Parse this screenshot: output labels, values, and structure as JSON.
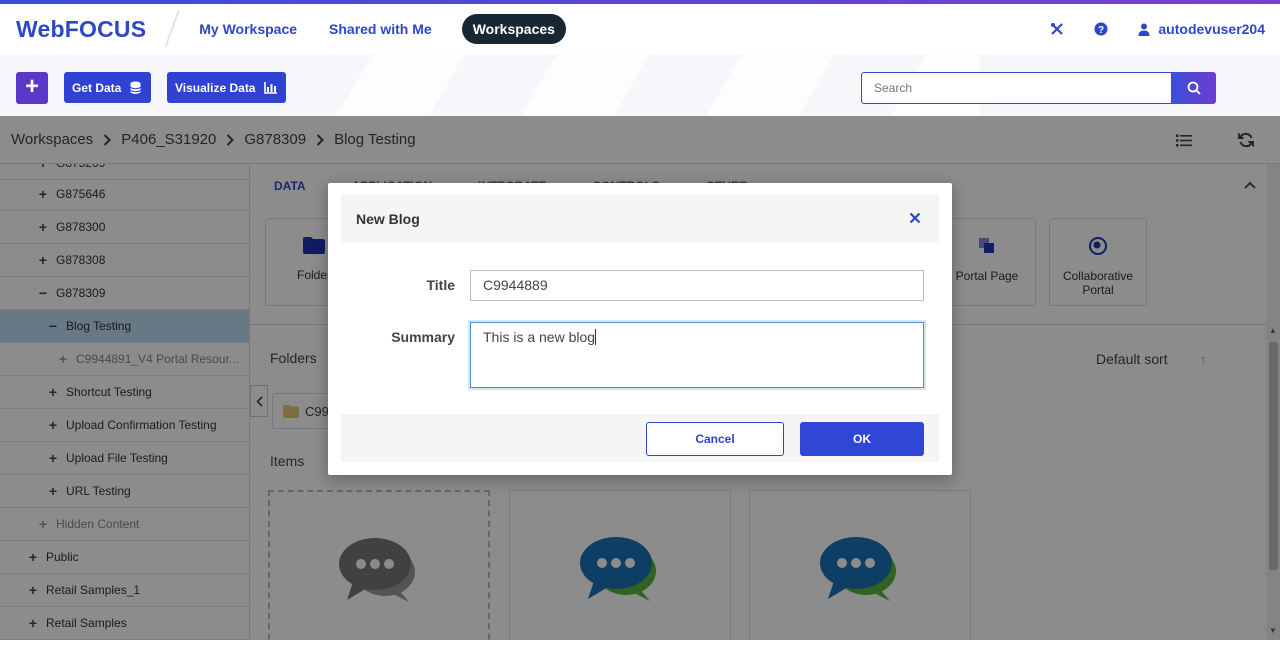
{
  "app": {
    "logo": "WebFOCUS"
  },
  "nav": {
    "my_workspace": "My Workspace",
    "shared": "Shared with Me",
    "workspaces": "Workspaces"
  },
  "user": {
    "name": "autodevuser204"
  },
  "toolbar": {
    "get_data": "Get Data",
    "visualize_data": "Visualize Data",
    "search_placeholder": "Search"
  },
  "breadcrumb": [
    "Workspaces",
    "P406_S31920",
    "G878309",
    "Blog Testing"
  ],
  "sidebar": {
    "items": [
      {
        "label": "G875646",
        "toggle": "+"
      },
      {
        "label": "G878300",
        "toggle": "+"
      },
      {
        "label": "G878308",
        "toggle": "+"
      },
      {
        "label": "G878309",
        "toggle": "−"
      },
      {
        "label": "Blog Testing",
        "toggle": "−"
      },
      {
        "label": "C9944891_V4 Portal Resour...",
        "toggle": "+"
      },
      {
        "label": "Shortcut Testing",
        "toggle": "+"
      },
      {
        "label": "Upload Confirmation Testing",
        "toggle": "+"
      },
      {
        "label": "Upload File Testing",
        "toggle": "+"
      },
      {
        "label": "URL Testing",
        "toggle": "+"
      },
      {
        "label": "Hidden Content",
        "toggle": "+"
      },
      {
        "label": "Public",
        "toggle": "+"
      },
      {
        "label": "Retail Samples_1",
        "toggle": "+"
      },
      {
        "label": "Retail Samples",
        "toggle": "+"
      }
    ]
  },
  "main": {
    "tabs": [
      "DATA",
      "APPLICATION",
      "INTEGRATE",
      "CONTROLS",
      "OTHER"
    ],
    "tiles": {
      "folder": "Folder",
      "portal_page": "Portal Page",
      "collab_portal": "Collaborative Portal"
    },
    "folders_label": "Folders",
    "sort_label": "Default sort",
    "folder_chip": "C99",
    "items_label": "Items"
  },
  "dialog": {
    "title": "New Blog",
    "title_label": "Title",
    "title_value": "C9944889",
    "summary_label": "Summary",
    "summary_value": "This is a new blog",
    "cancel": "Cancel",
    "ok": "OK"
  },
  "colors": {
    "brand": "#2f46c7",
    "accent_purple": "#5a36c9",
    "selected": "#bcdcf0"
  }
}
